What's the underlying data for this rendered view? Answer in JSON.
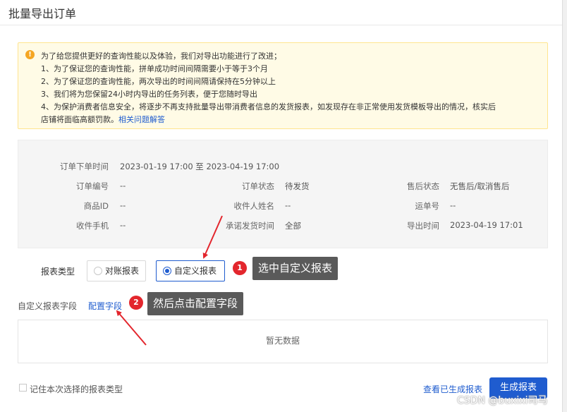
{
  "dialog": {
    "title": "批量导出订单"
  },
  "notice": {
    "line1": "为了给您提供更好的查询性能以及体验，我们对导出功能进行了改进；",
    "line2": "1、为了保证您的查询性能，拼单成功时间间隔需要小于等于3个月",
    "line3": "2、为了保证您的查询性能，两次导出的时间间隔请保持在5分钟以上",
    "line4": "3、我们将为您保留24小时内导出的任务列表，便于您随时导出",
    "line5": "4、为保护消费者信息安全，将逐步不再支持批量导出带消费者信息的发货报表，如发现存在非正常使用发货模板导出的情况，核实后",
    "line6": "店铺将面临高额罚款。",
    "link": "相关问题解答"
  },
  "filters": {
    "order_time_label": "订单下单时间",
    "order_time_value": "2023-01-19 17:00 至 2023-04-19 17:00",
    "order_no_label": "订单编号",
    "order_no_value": "--",
    "order_status_label": "订单状态",
    "order_status_value": "待发货",
    "after_sale_label": "售后状态",
    "after_sale_value": "无售后/取消售后",
    "product_id_label": "商品ID",
    "product_id_value": "--",
    "receiver_name_label": "收件人姓名",
    "receiver_name_value": "--",
    "waybill_label": "运单号",
    "waybill_value": "--",
    "receiver_phone_label": "收件手机",
    "receiver_phone_value": "--",
    "promise_time_label": "承诺发货时间",
    "promise_time_value": "全部",
    "export_time_label": "导出时间",
    "export_time_value": "2023-04-19 17:01"
  },
  "report_type": {
    "label": "报表类型",
    "options": [
      "对账报表",
      "自定义报表"
    ],
    "selected": "自定义报表"
  },
  "annotations": {
    "badge1": "1",
    "tip1": "选中自定义报表",
    "badge2": "2",
    "tip2": "然后点击配置字段"
  },
  "custom_fields": {
    "label": "自定义报表字段",
    "config_link": "配置字段",
    "empty_text": "暂无数据"
  },
  "footer": {
    "remember_label": "记住本次选择的报表类型",
    "view_link": "查看已生成报表",
    "generate_button": "生成报表",
    "watermark": "CSDN @buxixi司马"
  },
  "colors": {
    "accent": "#1f5ccf",
    "notice_bg": "#fffbe6",
    "badge": "#e3262d",
    "tip_bg": "#5a5a5a",
    "arrow": "#e3262d"
  }
}
